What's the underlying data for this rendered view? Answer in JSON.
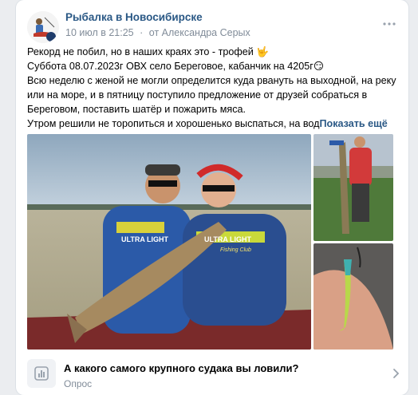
{
  "post": {
    "group_name": "Рыбалка в Новосибирске",
    "date": "10 июл в 21:25",
    "separator": "·",
    "author": "от Александра Серых",
    "text_lines": [
      "Рекорд не побил, но в наших краях это - трофей 🤟",
      "Суббота 08.07.2023г ОВХ село Береговое, кабанчик на 4205г😏",
      "Всю неделю с женой не могли определится куда рвануть на выходной, на реку или на море, и в пятницу поступило предложение от друзей собраться в Береговом, поставить шатёр и пожарить мяса.",
      "Утром решили не торопиться и хорошенько выспаться, на вод"
    ],
    "show_more": "Показать ещё",
    "photo_shirt_texts": [
      "ULTRA LIGHT",
      "ULTRA LIGHT",
      "Fishing Club"
    ],
    "accent": "#2a5885"
  },
  "poll": {
    "question": "А какого самого крупного судака вы ловили?",
    "type": "Опрос"
  }
}
